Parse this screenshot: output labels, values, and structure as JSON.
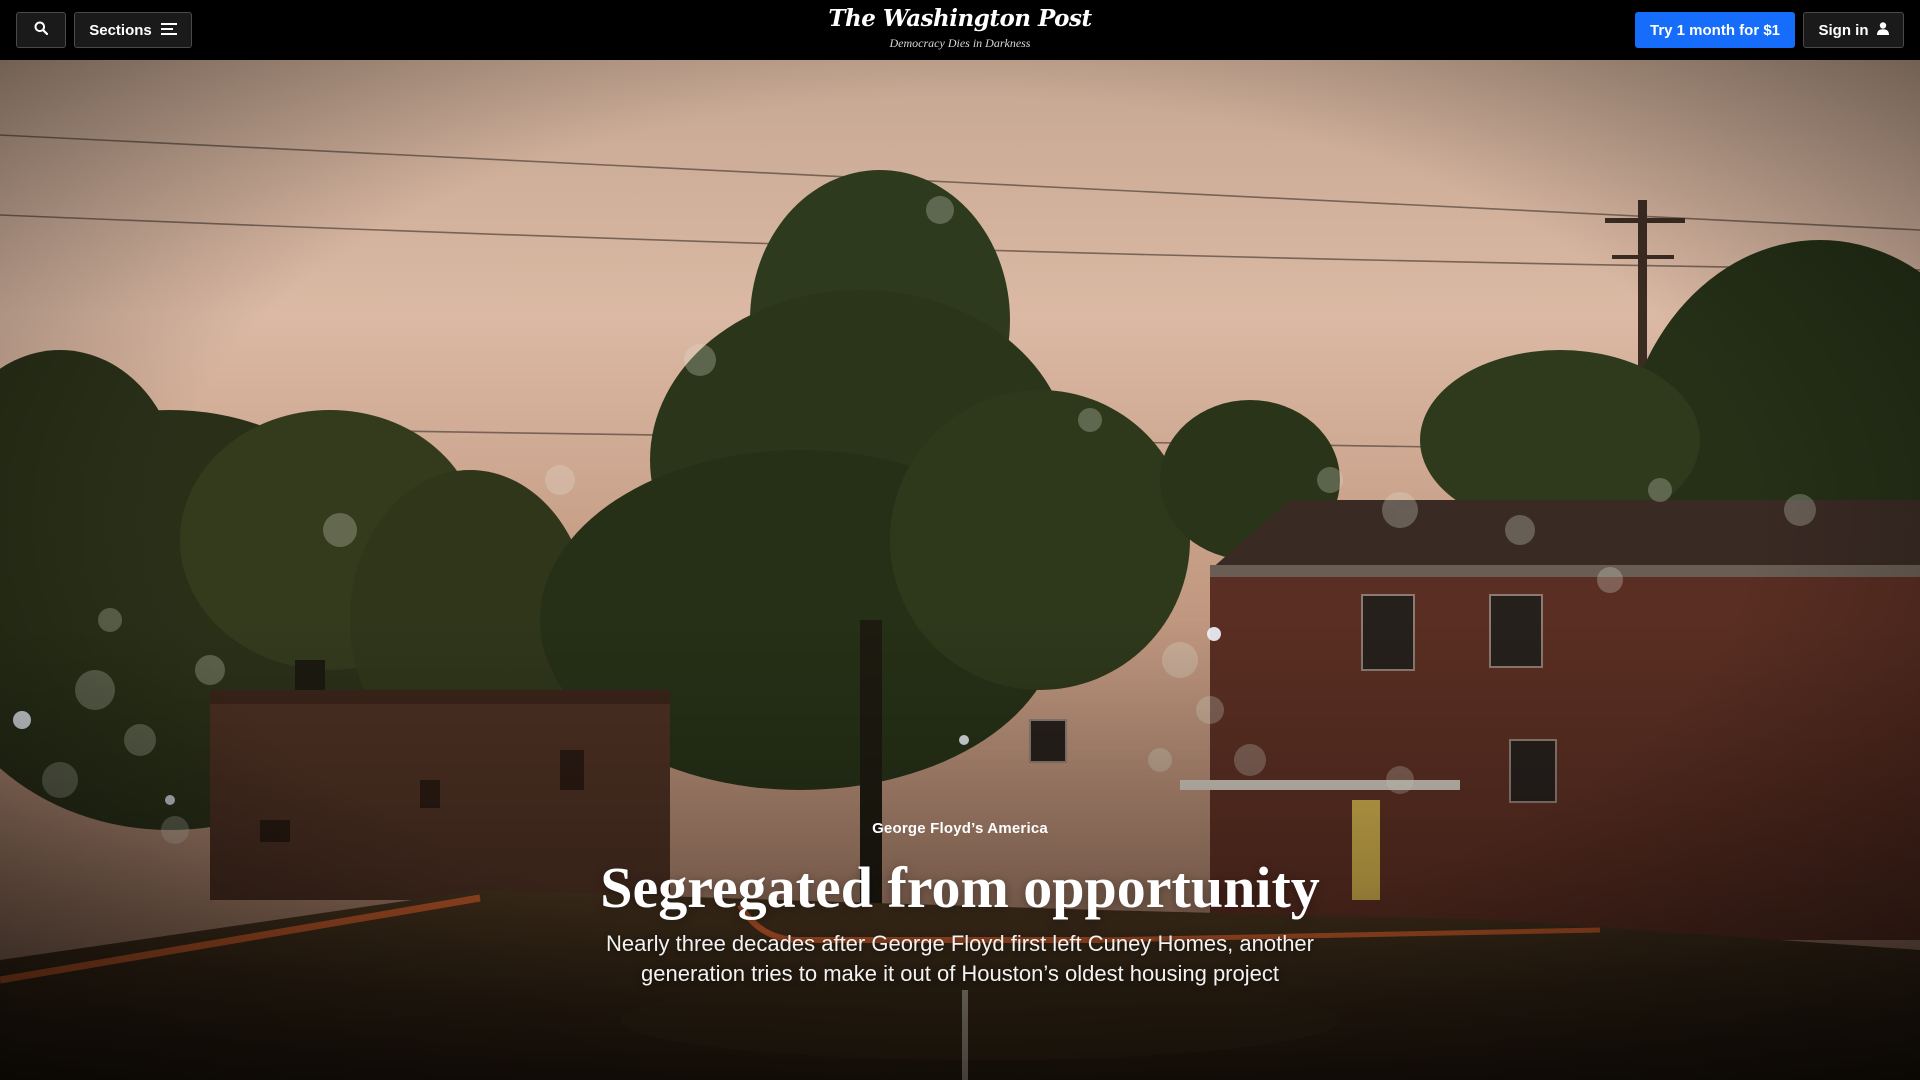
{
  "header": {
    "search_icon": "search-icon",
    "sections_label": "Sections",
    "sections_icon": "hamburger-menu-icon",
    "masthead": "The Washington Post",
    "tagline": "Democracy Dies in Darkness",
    "subscribe_label": "Try 1 month for $1",
    "subscribe_color": "#166dfc",
    "signin_label": "Sign in",
    "signin_icon": "user-icon"
  },
  "hero": {
    "image_description_icon": "hero-photo",
    "kicker": "George Floyd’s America",
    "headline": "Segregated from opportunity",
    "dek": "Nearly three decades after George Floyd first left Cuney Homes, another generation tries to make it out of Houston’s oldest housing project"
  }
}
